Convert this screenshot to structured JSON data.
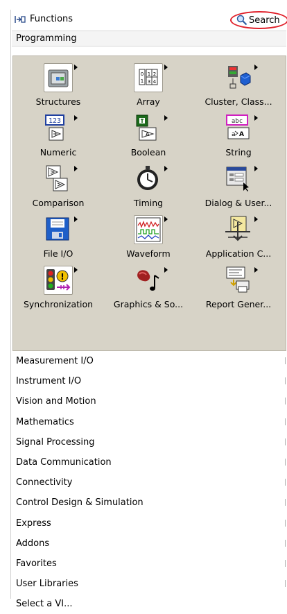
{
  "window": {
    "title": "Functions",
    "search_label": "Search"
  },
  "category": {
    "name": "Programming"
  },
  "palette": {
    "items": [
      {
        "label": "Structures",
        "icon": "structures-icon"
      },
      {
        "label": "Array",
        "icon": "array-icon"
      },
      {
        "label": "Cluster, Class...",
        "icon": "cluster-class-icon"
      },
      {
        "label": "Numeric",
        "icon": "numeric-icon"
      },
      {
        "label": "Boolean",
        "icon": "boolean-icon"
      },
      {
        "label": "String",
        "icon": "string-icon"
      },
      {
        "label": "Comparison",
        "icon": "comparison-icon"
      },
      {
        "label": "Timing",
        "icon": "timing-icon"
      },
      {
        "label": "Dialog & User...",
        "icon": "dialog-user-icon"
      },
      {
        "label": "File I/O",
        "icon": "file-io-icon"
      },
      {
        "label": "Waveform",
        "icon": "waveform-icon"
      },
      {
        "label": "Application C...",
        "icon": "application-control-icon"
      },
      {
        "label": "Synchronization",
        "icon": "synchronization-icon"
      },
      {
        "label": "Graphics & So...",
        "icon": "graphics-sound-icon"
      },
      {
        "label": "Report Gener...",
        "icon": "report-generation-icon"
      }
    ]
  },
  "categories": [
    "Measurement I/O",
    "Instrument I/O",
    "Vision and Motion",
    "Mathematics",
    "Signal Processing",
    "Data Communication",
    "Connectivity",
    "Control Design & Simulation",
    "Express",
    "Addons",
    "Favorites",
    "User Libraries",
    "Select a VI..."
  ],
  "array_icon_cells": [
    "0",
    "1",
    "2",
    "3",
    "4"
  ],
  "numeric_icon_text": "123",
  "string_icon_text": "abc",
  "colors": {
    "palette_bg": "#d7d3c7",
    "highlight_ring": "#e0202a"
  }
}
